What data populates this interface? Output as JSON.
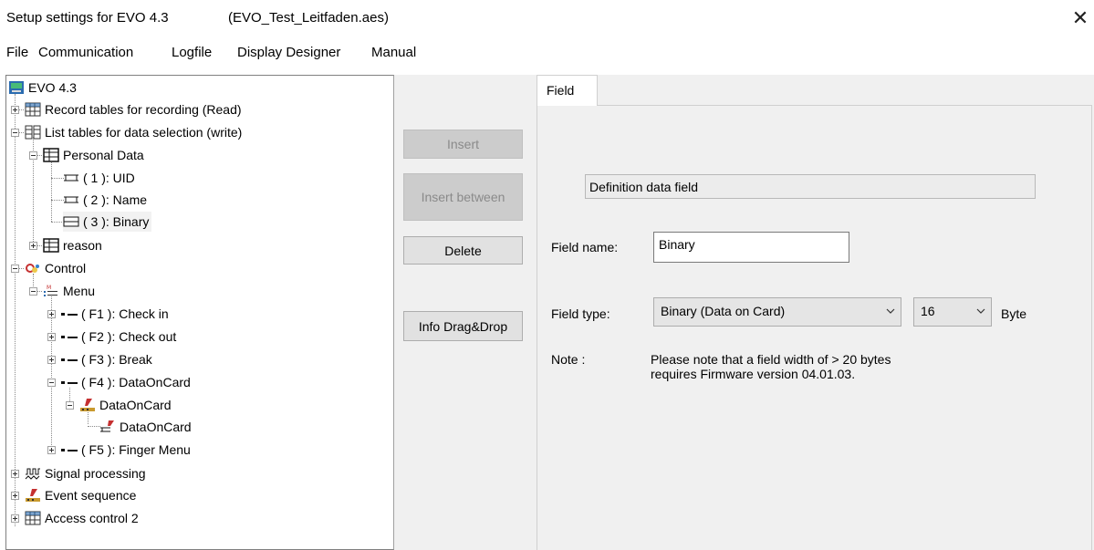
{
  "window": {
    "title": "Setup settings for EVO 4.3",
    "file": "(EVO_Test_Leitfaden.aes)",
    "close_glyph": "✕"
  },
  "menu": [
    "File",
    "Communication",
    "Logfile",
    "Display Designer",
    "Manual"
  ],
  "tree": {
    "root": "EVO 4.3",
    "record_tables": "Record tables for recording (Read)",
    "list_tables": "List tables for data selection (write)",
    "personal_data": "Personal Data",
    "field_uid": "( 1 ): UID",
    "field_name": "( 2 ): Name",
    "field_binary": "( 3 ): Binary",
    "reason": "reason",
    "control": "Control",
    "menu": "Menu",
    "f1": "( F1 ): Check in",
    "f2": "( F2 ): Check out",
    "f3": "( F3 ): Break",
    "f4": "( F4 ): DataOnCard",
    "doc1": "DataOnCard",
    "doc2": "DataOnCard",
    "f5": "( F5 ): Finger Menu",
    "signal": "Signal processing",
    "event": "Event sequence",
    "access": "Access control 2"
  },
  "buttons": {
    "insert": "Insert",
    "insert_between": "Insert between",
    "delete": "Delete",
    "info": "Info Drag&Drop"
  },
  "panel": {
    "tab": "Field",
    "group_title": "Definition data field",
    "field_name_label": "Field name:",
    "field_name_value": "Binary",
    "field_type_label": "Field type:",
    "field_type_value": "Binary (Data on Card)",
    "size_value": "16",
    "unit": "Byte",
    "note_label": "Note :",
    "note_line1": "Please note that a field width of > 20 bytes",
    "note_line2": "requires Firmware version 04.01.03."
  },
  "colors": {
    "panel_bg": "#f0f0f0",
    "button_bg": "#e1e1e1",
    "disabled_bg": "#cccccc"
  }
}
